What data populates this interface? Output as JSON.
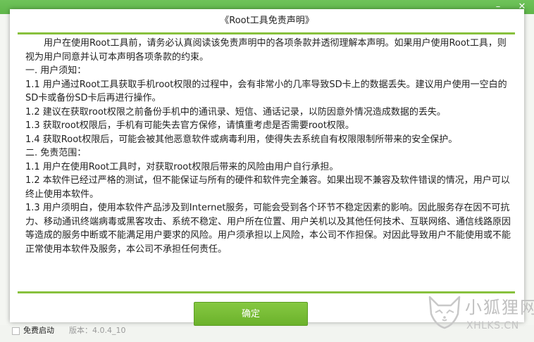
{
  "background_app": {
    "minimize_glyph": "–",
    "close_glyph": "✕",
    "statusbar": {
      "checkbox_label": "免费启动",
      "version_text": "版本：4.0.4_10"
    }
  },
  "dialog": {
    "title": "《Root工具免责声明》",
    "accent_color": "#88c13d",
    "paragraphs": [
      "用户在使用Root工具前，请务必认真阅读该免责声明中的各项条款并透彻理解本声明。如果用户使用Root工具，则视为用户同意并认可本声明各项条款的约束。",
      "一. 用户须知：",
      "1.1  用户通过Root工具获取手机root权限的过程中，会有非常小的几率导致SD卡上的数据丢失。建议用户使用一空白的SD卡或备份SD卡后再进行操作。",
      "1.2  建议在获取root权限之前备份手机中的通讯录、短信、通话记录，以防因意外情况造成数据的丢失。",
      "1.3  获取root权限后，手机有可能失去官方保修，请慎重考虑是否需要root权限。",
      "1.4  获取Root权限后，可能会被其他恶意软件或病毒利用，使得失去系统自有权限限制所带来的安全保护。",
      "二. 免责范围：",
      "1.1  用户在使用Root工具时，对获取root权限后带来的风险由用户自行承担。",
      "1.2  本软件已经过严格的测试，但不能保证与所有的硬件和软件完全兼容。如果出现不兼容及软件错误的情况，用户可以终止使用本软件。",
      "1.3  用户须明白，使用本软件产品涉及到Internet服务，可能会受到各个环节不稳定因素的影响。因此服务存在因不可抗力、移动通讯终端病毒或黑客攻击、系统不稳定、用户所在位置、用户关机以及其他任何技术、互联网络、通信线路原因等造成的服务中断或不能满足用户要求的风险。用户须承担以上风险，本公司不作担保。对因此导致用户不能使用或不能正常使用本软件及服务，本公司不承担任何责任。"
    ],
    "confirm_label": "确定",
    "confirm_color": "#76bb33"
  },
  "watermark": {
    "text_cn": "小狐狸网",
    "text_en": "XHLKS.CN",
    "icon": "fox-logo-icon"
  }
}
